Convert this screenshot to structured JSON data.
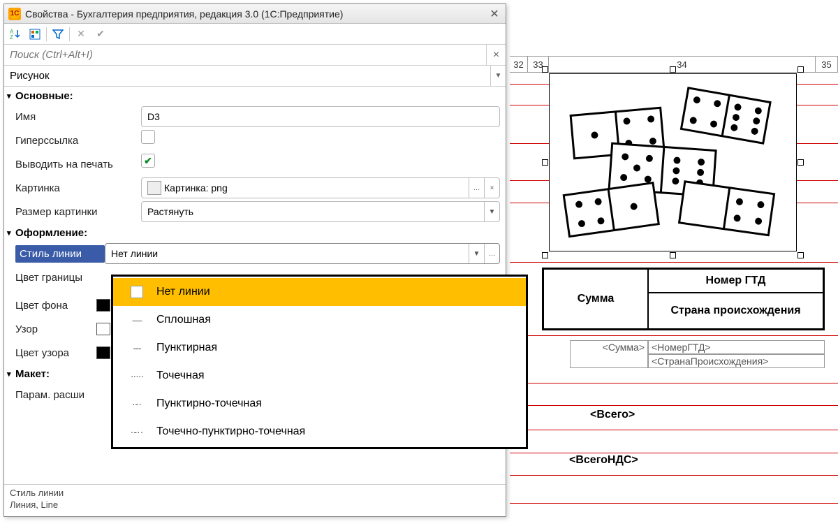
{
  "window": {
    "title": "Свойства - Бухгалтерия предприятия, редакция 3.0  (1С:Предприятие)",
    "search_placeholder": "Поиск (Ctrl+Alt+I)",
    "object_type": "Рисунок"
  },
  "sections": {
    "basic": "Основные:",
    "design": "Оформление:",
    "layout": "Макет:"
  },
  "props": {
    "name_label": "Имя",
    "name_value": "D3",
    "hyperlink_label": "Гиперссылка",
    "print_label": "Выводить на печать",
    "picture_label": "Картинка",
    "picture_value": "Картинка: png",
    "picsize_label": "Размер картинки",
    "picsize_value": "Растянуть",
    "linestyle_label": "Стиль линии",
    "linestyle_value": "Нет линии",
    "bordercolor_label": "Цвет границы",
    "bgcolor_label": "Цвет фона",
    "pattern_label": "Узор",
    "patterncolor_label": "Цвет узора",
    "extparam_label": "Парам. расши"
  },
  "dropdown": {
    "items": [
      "Нет линии",
      "Сплошная",
      "Пунктирная",
      "Точечная",
      "Пунктирно-точечная",
      "Точечно-пунктирно-точечная"
    ]
  },
  "footer": {
    "line1": "Стиль линии",
    "line2": "Линия, Line"
  },
  "sheet": {
    "cols": [
      "32",
      "33",
      "34",
      "35"
    ],
    "head_sum": "Сумма",
    "head_gtd": "Номер ГТД",
    "head_country": "Страна происхождения",
    "ph_sum": "<Сумма>",
    "ph_gtd": "<НомерГТД>",
    "ph_country": "<СтранаПроисхождения>",
    "total": "<Всего>",
    "total_vat": "<ВсегоНДС>"
  }
}
